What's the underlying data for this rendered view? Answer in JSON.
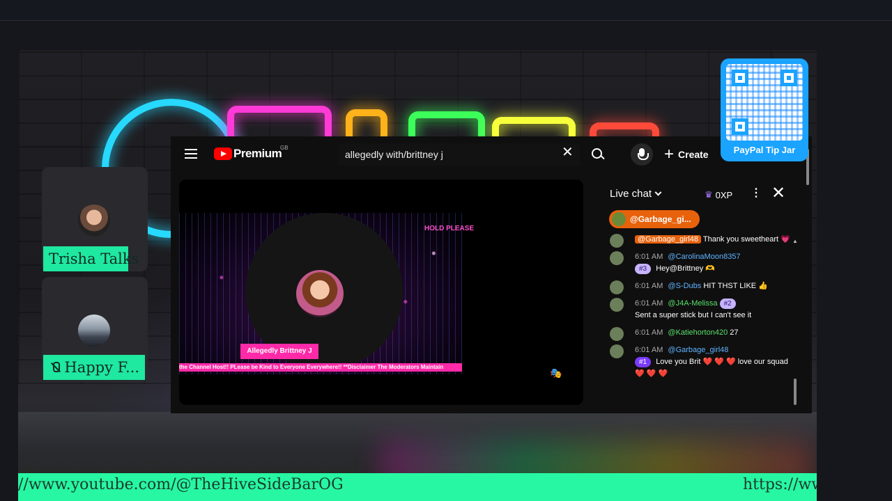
{
  "cams": [
    {
      "label": "Trisha Talks"
    },
    {
      "label": "Happy F..."
    }
  ],
  "youtube": {
    "brand": "Premium",
    "region": "GB",
    "search_value": "allegedly with/brittney j",
    "create_label": "Create"
  },
  "stream": {
    "hold_text": "HOLD PLEASE",
    "name_tag": "Allegedly Brittney J",
    "ticker": "the Channel Host!! PLease be Kind to Everyone Everywhere!! **Disclaimer The Moderators Maintain"
  },
  "live_chat": {
    "title": "Live chat",
    "xp": "0XP",
    "pinned_author": "@Garbage_gi...",
    "messages": [
      {
        "time": "",
        "author": "@Garbage_girl48",
        "badge": "",
        "text": "Thank you sweetheart 💗"
      },
      {
        "time": "6:01 AM",
        "author": "@CarolinaMoon8357",
        "badge": "#3",
        "text": "Hey@Brittney 🫶"
      },
      {
        "time": "6:01 AM",
        "author": "@S-Dubs",
        "badge": "",
        "text": "HIT THST LIKE 👍"
      },
      {
        "time": "6:01 AM",
        "author": "@J4A-Melissa",
        "badge": "#2",
        "text": "Sent a super stick but I can't see it"
      },
      {
        "time": "6:01 AM",
        "author": "@Katiehorton420",
        "badge": "",
        "text": "27"
      },
      {
        "time": "6:01 AM",
        "author": "@Garbage_girl48",
        "badge": "#1",
        "text": "Love you Brit ❤️ ❤️ ❤️ love our squad ❤️ ❤️ ❤️"
      }
    ]
  },
  "paypal": {
    "label": "PayPal Tip Jar"
  },
  "footer": {
    "left": "//www.youtube.com/@TheHiveSideBarOG",
    "right": "https://ww"
  },
  "colors": {
    "accent_green": "#27f7a2",
    "yt_red": "#ff0000",
    "chat_badge": "#c7b4ff",
    "pinned": "#e8620c"
  }
}
